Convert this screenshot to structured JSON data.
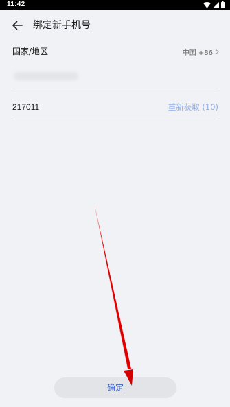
{
  "status_bar": {
    "time": "11:42"
  },
  "header": {
    "title": "绑定新手机号"
  },
  "form": {
    "country_label": "国家/地区",
    "country_value": "中国 +86",
    "verification_code": "217011",
    "resend_label": "重新获取 (10)"
  },
  "footer": {
    "confirm_label": "确定"
  },
  "colors": {
    "background": "#f1f2f5",
    "accent": "#3c63c4",
    "resend_link": "#93aee6",
    "annotation_arrow": "#e00000"
  }
}
